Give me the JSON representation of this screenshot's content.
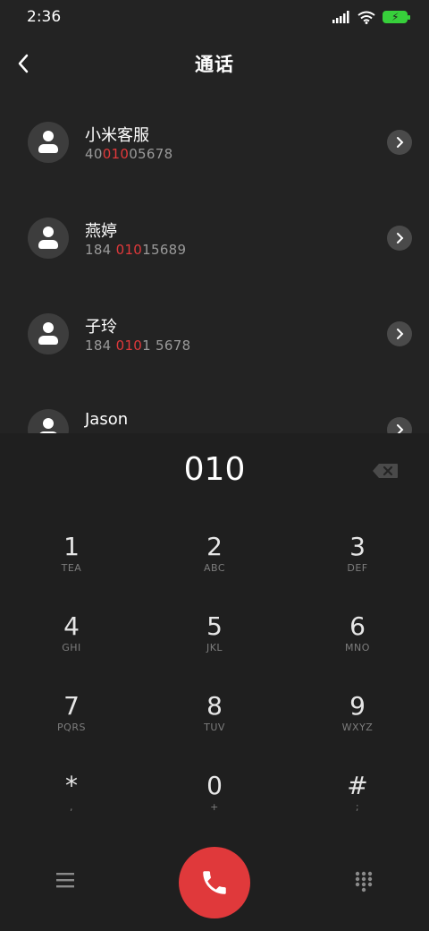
{
  "status_bar": {
    "time": "2:36"
  },
  "header": {
    "title": "通话"
  },
  "contacts": [
    {
      "name": "小米客服",
      "number_parts": [
        "40",
        "010",
        "05678"
      ]
    },
    {
      "name": "燕婷",
      "number_parts": [
        "184 ",
        "010",
        "15689"
      ]
    },
    {
      "name": "子玲",
      "number_parts": [
        "184 ",
        "010",
        "1 5678"
      ]
    },
    {
      "name": "Jason",
      "number_parts": [
        "",
        "",
        ""
      ]
    }
  ],
  "dialpad": {
    "input": "010",
    "keys": [
      {
        "digit": "1",
        "letters": "TEA"
      },
      {
        "digit": "2",
        "letters": "ABC"
      },
      {
        "digit": "3",
        "letters": "DEF"
      },
      {
        "digit": "4",
        "letters": "GHI"
      },
      {
        "digit": "5",
        "letters": "JKL"
      },
      {
        "digit": "6",
        "letters": "MNO"
      },
      {
        "digit": "7",
        "letters": "PQRS"
      },
      {
        "digit": "8",
        "letters": "TUV"
      },
      {
        "digit": "9",
        "letters": "WXYZ"
      },
      {
        "digit": "*",
        "letters": ","
      },
      {
        "digit": "0",
        "letters": "+"
      },
      {
        "digit": "#",
        "letters": ";"
      }
    ]
  },
  "icons": {
    "back": "chevron-left-icon",
    "signal": "signal-icon",
    "wifi": "wifi-icon",
    "battery": "battery-charging-icon",
    "detail": "chevron-right-icon",
    "backspace": "backspace-icon",
    "menu": "menu-icon",
    "call": "phone-icon",
    "keypad": "keypad-icon"
  },
  "colors": {
    "accent": "#e0393b",
    "battery": "#37d03b"
  }
}
